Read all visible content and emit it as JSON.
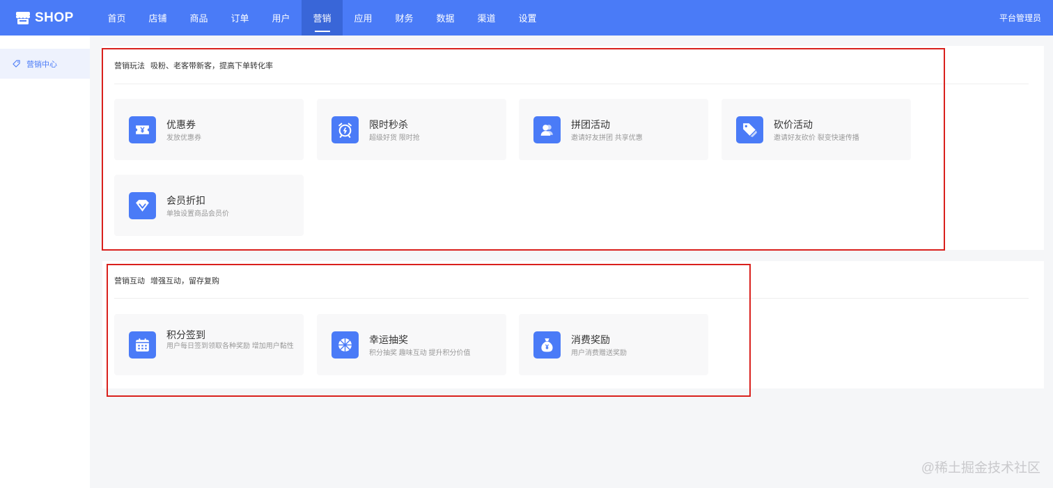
{
  "brand": {
    "logo_text": "SHOP",
    "primary_color": "#4a7bf7"
  },
  "nav": {
    "items": [
      "首页",
      "店铺",
      "商品",
      "订单",
      "用户",
      "营销",
      "应用",
      "财务",
      "数据",
      "渠道",
      "设置"
    ],
    "active": "营销",
    "admin": "平台管理员"
  },
  "sidebar": {
    "items": [
      {
        "label": "营销中心",
        "icon": "tag-icon",
        "active": true
      }
    ]
  },
  "sections": [
    {
      "title": "营销玩法",
      "subtitle": "吸粉、老客带新客，提高下单转化率",
      "cards": [
        {
          "title": "优惠券",
          "desc": "发放优惠券",
          "icon": "coupon-icon"
        },
        {
          "title": "限时秒杀",
          "desc": "超级好货 限时抢",
          "icon": "alarm-clock-icon"
        },
        {
          "title": "拼团活动",
          "desc": "邀请好友拼团 共享优惠",
          "icon": "group-users-icon"
        },
        {
          "title": "砍价活动",
          "desc": "邀请好友砍价 裂变快速传播",
          "icon": "price-tag-icon"
        },
        {
          "title": "会员折扣",
          "desc": "单独设置商品会员价",
          "icon": "diamond-icon"
        }
      ]
    },
    {
      "title": "营销互动",
      "subtitle": "增强互动，留存复购",
      "cards": [
        {
          "title": "积分签到",
          "desc": "用户每日签到领取各种奖励 增加用户黏性",
          "icon": "calendar-icon"
        },
        {
          "title": "幸运抽奖",
          "desc": "积分抽奖 趣味互动 提升积分价值",
          "icon": "lucky-wheel-icon"
        },
        {
          "title": "消费奖励",
          "desc": "用户消费赠送奖励",
          "icon": "money-bag-icon"
        }
      ]
    }
  ],
  "watermark": "@稀土掘金技术社区",
  "annotation_color": "#d9201c"
}
